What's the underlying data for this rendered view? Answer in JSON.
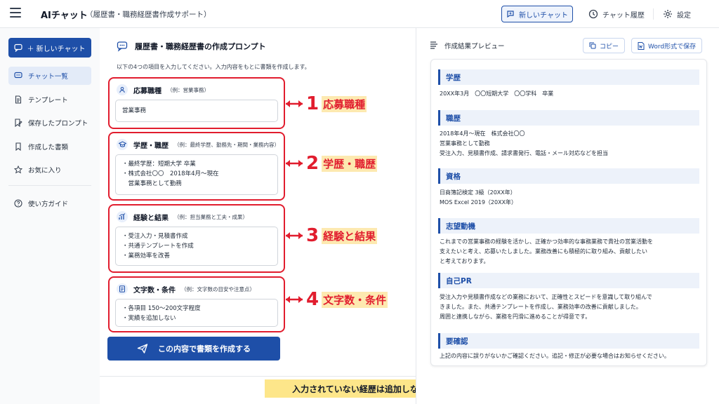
{
  "topbar": {
    "title": "AIチャット",
    "subtitle": "（履歴書・職務経歴書作成サポート）",
    "new_chat": "新しいチャット",
    "history": "チャット履歴",
    "settings": "設定"
  },
  "sidebar": {
    "new_chat": "＋ 新しいチャット",
    "items": [
      {
        "label": "チャット一覧",
        "icon": "chat-bubble-icon"
      },
      {
        "label": "テンプレート",
        "icon": "document-icon"
      },
      {
        "label": "保存したプロンプト",
        "icon": "bookmark-edit-icon"
      },
      {
        "label": "作成した書類",
        "icon": "bookmark-icon"
      },
      {
        "label": "お気に入り",
        "icon": "star-icon"
      }
    ],
    "guide": "使い方ガイド"
  },
  "prompt_panel": {
    "title": "履歴書・職務経歴書の作成プロンプト",
    "description": "以下の4つの項目を入力してください。入力内容をもとに書類を作成します。",
    "fields": [
      {
        "label": "応募職種",
        "example": "（例：営業事務）",
        "lines": [
          "営業事務"
        ],
        "annotation_num": "1",
        "annotation_text": "応募職種"
      },
      {
        "label": "学歴・職歴",
        "example": "（例：最終学歴、勤務先・期間・業務内容）",
        "lines": [
          "・最終学歴：短期大学 卒業",
          "・株式会社〇〇　2018年4月～現在",
          "　営業事務として勤務"
        ],
        "annotation_num": "2",
        "annotation_text": "学歴・職歴"
      },
      {
        "label": "経験と結果",
        "example": "（例：担当業務と工夫・成果）",
        "lines": [
          "・受注入力・見積書作成",
          "・共通テンプレートを作成",
          "・業務効率を改善"
        ],
        "annotation_num": "3",
        "annotation_text": "経験と結果"
      },
      {
        "label": "文字数・条件",
        "example": "（例：文字数の目安や注意点）",
        "lines": [
          "・各項目 150～200文字程度",
          "・実績を追加しない"
        ],
        "annotation_num": "4",
        "annotation_text": "文字数・条件"
      }
    ],
    "create_button": "この内容で書類を作成する"
  },
  "bottom_note": "入力されていない経歴は追加しない",
  "preview": {
    "title": "作成結果プレビュー",
    "copy": "コピー",
    "save_word": "Word形式で保存",
    "sections": [
      {
        "heading": "学歴",
        "lines": [
          "20XX年3月　〇〇短期大学　〇〇学科　卒業"
        ]
      },
      {
        "heading": "職歴",
        "lines": [
          "2018年4月～現在　株式会社〇〇",
          "営業事務として勤務",
          "受注入力、見積書作成、請求書発行、電話・メール対応などを担当"
        ]
      },
      {
        "heading": "資格",
        "lines": [
          "日商簿記検定 3級（20XX年）",
          "MOS Excel 2019（20XX年）"
        ]
      },
      {
        "heading": "志望動機",
        "lines": [
          "これまでの営業事務の経験を活かし、正確かつ効率的な事務業務で貴社の営業活動を",
          "支えたいと考え、応募いたしました。業務改善にも積極的に取り組み、貢献したい",
          "と考えております。"
        ]
      },
      {
        "heading": "自己PR",
        "lines": [
          "受注入力や見積書作成などの業務において、正確性とスピードを意識して取り組んで",
          "きました。また、共通テンプレートを作成し、業務効率の改善に貢献しました。",
          "周囲と連携しながら、業務を円滑に進めることが得意です。"
        ]
      },
      {
        "heading": "要確認",
        "lines": [
          "上記の内容に誤りがないかご確認ください。追記・修正が必要な場合はお知らせください。"
        ]
      }
    ]
  },
  "colors": {
    "accent": "#1e4fa8",
    "annotation_red": "#e11d2e",
    "highlight_yellow": "#fde68a"
  }
}
